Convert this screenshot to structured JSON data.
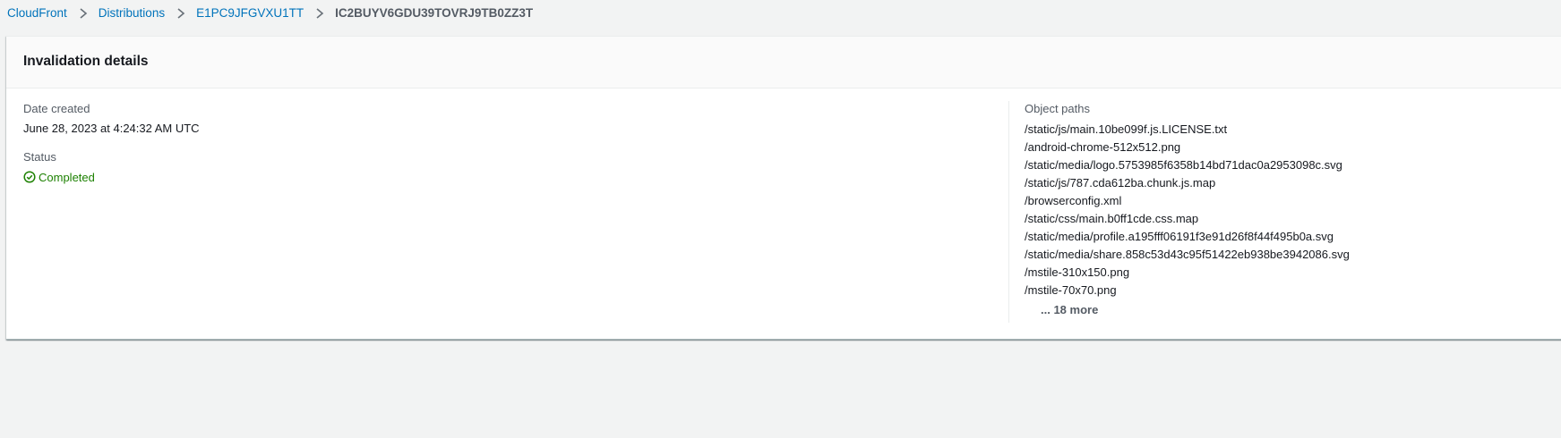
{
  "breadcrumb": {
    "items": [
      {
        "label": "CloudFront"
      },
      {
        "label": "Distributions"
      },
      {
        "label": "E1PC9JFGVXU1TT"
      }
    ],
    "current": "IC2BUYV6GDU39TOVRJ9TB0ZZ3T"
  },
  "panel": {
    "title": "Invalidation details",
    "date_created_label": "Date created",
    "date_created_value": "June 28, 2023 at 4:24:32 AM UTC",
    "status_label": "Status",
    "status_value": "Completed",
    "object_paths_label": "Object paths",
    "object_paths": [
      "/static/js/main.10be099f.js.LICENSE.txt",
      "/android-chrome-512x512.png",
      "/static/media/logo.5753985f6358b14bd71dac0a2953098c.svg",
      "/static/js/787.cda612ba.chunk.js.map",
      "/browserconfig.xml",
      "/static/css/main.b0ff1cde.css.map",
      "/static/media/profile.a195fff06191f3e91d26f8f44f495b0a.svg",
      "/static/media/share.858c53d43c95f51422eb938be3942086.svg",
      "/mstile-310x150.png",
      "/mstile-70x70.png"
    ],
    "more_label": "... 18 more"
  },
  "colors": {
    "link": "#0073bb",
    "success": "#1d8102",
    "background": "#f2f3f3"
  },
  "icons": {
    "breadcrumb_separator": "chevron-right-icon",
    "status": "status-check-circle-icon"
  }
}
